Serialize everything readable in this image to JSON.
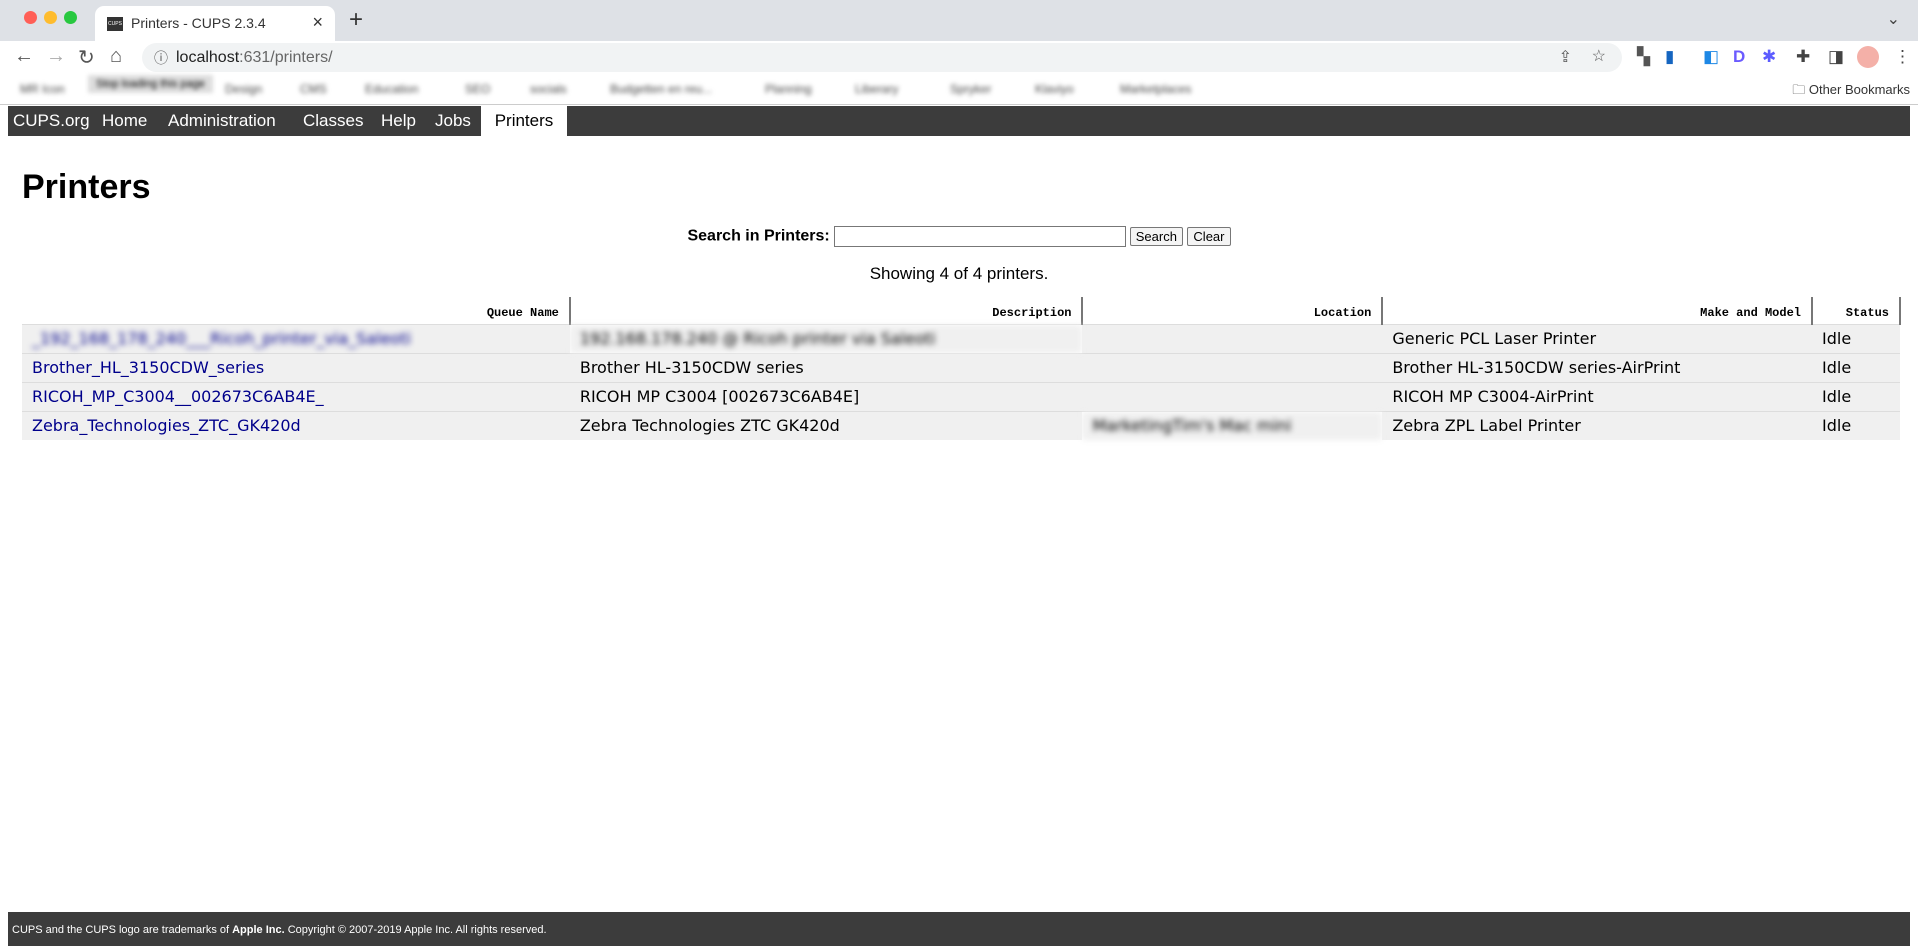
{
  "browser": {
    "tab_title": "Printers - CUPS 2.3.4",
    "favicon_text": "CUPS",
    "url_host": "localhost",
    "url_path": ":631/printers/",
    "tooltip": "Stop loading this page",
    "bookmarks": [
      "MR Icon",
      "Design",
      "CMS",
      "Education",
      "SEO",
      "socials",
      "Budgetten en reu...",
      "Planning",
      "Liberary",
      "Spryker",
      "Klaviyo",
      "Marketplaces"
    ],
    "other_bookmarks": "Other Bookmarks"
  },
  "nav": [
    "CUPS.org",
    "Home",
    "Administration",
    "Classes",
    "Help",
    "Jobs",
    "Printers"
  ],
  "page": {
    "title": "Printers",
    "search_label": "Search in Printers:",
    "search_value": "",
    "search_button": "Search",
    "clear_button": "Clear",
    "showing": "Showing 4 of 4 printers."
  },
  "table": {
    "headers": [
      "Queue Name",
      "Description",
      "Location",
      "Make and Model",
      "Status"
    ],
    "rows": [
      {
        "queue": "_192_168_178_240___Ricoh_printer_via_Saleoti",
        "description": "192.168.178.240 @ Ricoh printer via Saleoti",
        "location": "",
        "model": "Generic PCL Laser Printer",
        "status": "Idle"
      },
      {
        "queue": "Brother_HL_3150CDW_series",
        "description": "Brother HL-3150CDW series",
        "location": "",
        "model": "Brother HL-3150CDW series-AirPrint",
        "status": "Idle"
      },
      {
        "queue": "RICOH_MP_C3004__002673C6AB4E_",
        "description": "RICOH MP C3004 [002673C6AB4E]",
        "location": "",
        "model": "RICOH MP C3004-AirPrint",
        "status": "Idle"
      },
      {
        "queue": "Zebra_Technologies_ZTC_GK420d",
        "description": "Zebra Technologies ZTC GK420d",
        "location": "MarketingTim's Mac mini",
        "model": "Zebra ZPL Label Printer",
        "status": "Idle"
      }
    ]
  },
  "footer": {
    "pre": "CUPS and the CUPS logo are trademarks of ",
    "brand": "Apple Inc.",
    "post": " Copyright © 2007-2019 Apple Inc. All rights reserved."
  }
}
